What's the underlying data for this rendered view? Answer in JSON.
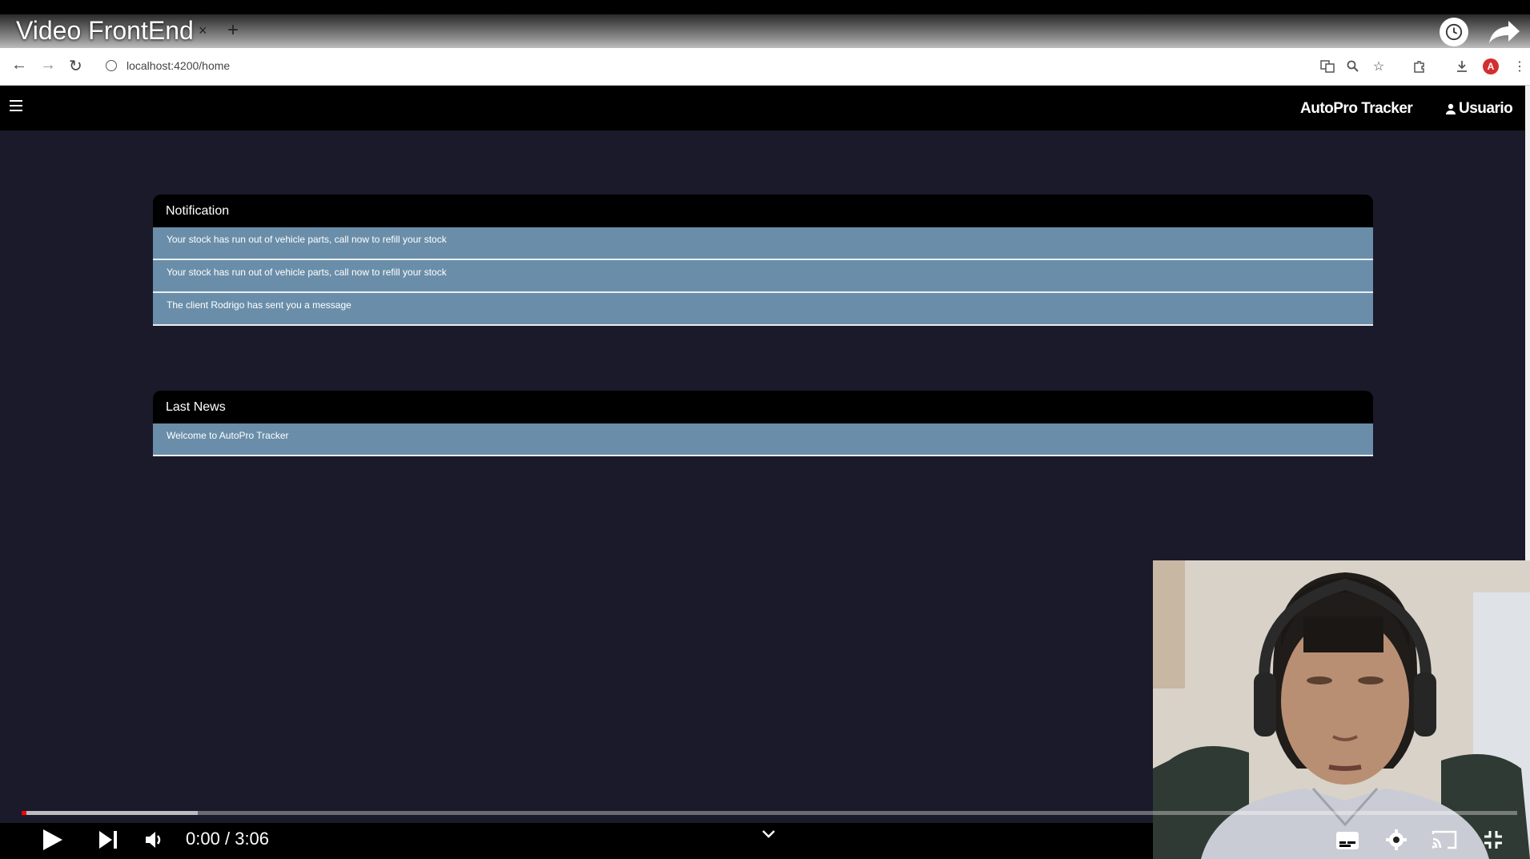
{
  "video": {
    "title": "Video FrontEnd",
    "time_current": "0:00",
    "time_separator": "/",
    "time_total": "3:06",
    "progress_played_fraction": 0.0,
    "progress_buffered_fraction": 0.118
  },
  "browser": {
    "tab_close": "×",
    "tab_new": "+",
    "url": "localhost:4200/home",
    "profile_letter": "A"
  },
  "app": {
    "brand": "AutoPro Tracker",
    "user_label": "Usuario",
    "notification": {
      "header": "Notification",
      "items": [
        "Your stock has run out of vehicle parts, call now to refill your stock",
        "Your stock has run out of vehicle parts, call now to refill your stock",
        "The client Rodrigo has sent you a message"
      ]
    },
    "news": {
      "header": "Last News",
      "items": [
        "Welcome to AutoPro Tracker"
      ]
    }
  },
  "colors": {
    "toolbar": "#000000",
    "body": "#1b1a2b",
    "item": "#6a8ea9",
    "progress": "#ff0000"
  },
  "icons": [
    "back-icon",
    "forward-icon",
    "reload-icon",
    "info-icon",
    "translate-icon",
    "zoom-icon",
    "star-icon",
    "extensions-icon",
    "download-icon",
    "menu-dots-icon",
    "hamburger-icon",
    "user-icon",
    "play-icon",
    "next-icon",
    "volume-icon",
    "chevron-down-icon",
    "subtitles-icon",
    "settings-icon",
    "cast-icon",
    "exit-fullscreen-icon",
    "clock-icon",
    "share-icon"
  ]
}
